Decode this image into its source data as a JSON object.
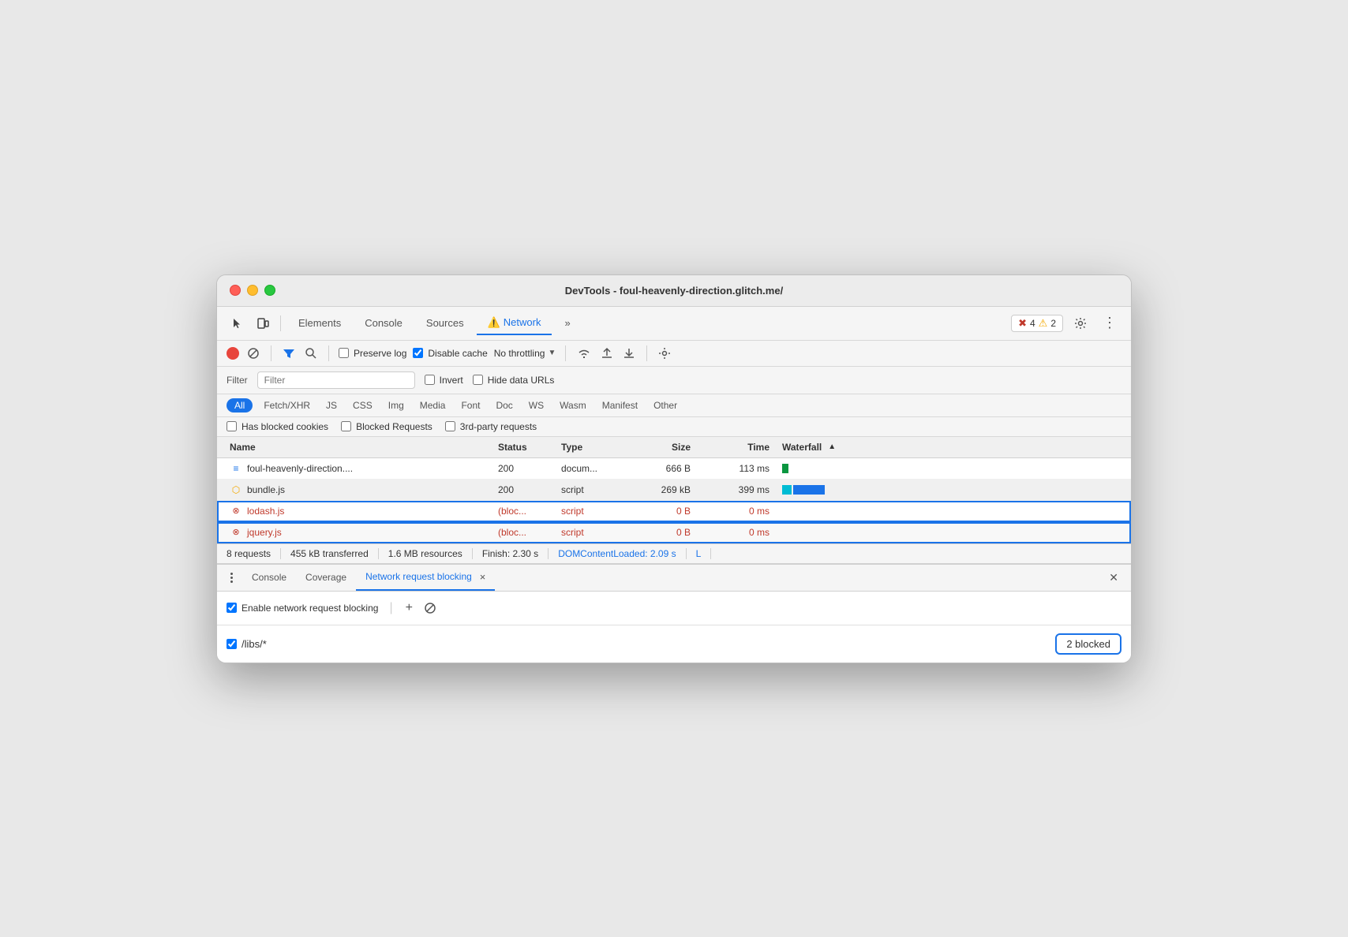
{
  "window": {
    "title": "DevTools - foul-heavenly-direction.glitch.me/"
  },
  "titlebar": {
    "title": "DevTools - foul-heavenly-direction.glitch.me/"
  },
  "tabs": {
    "items": [
      {
        "label": "Elements",
        "active": false
      },
      {
        "label": "Console",
        "active": false
      },
      {
        "label": "Sources",
        "active": false
      },
      {
        "label": "Network",
        "active": true,
        "warning": true
      },
      {
        "label": "»",
        "active": false
      }
    ]
  },
  "badges": {
    "error_count": "4",
    "warning_count": "2"
  },
  "network_toolbar": {
    "preserve_log": "Preserve log",
    "disable_cache": "Disable cache",
    "throttling": "No throttling"
  },
  "filter_bar": {
    "filter_label": "Filter",
    "invert_label": "Invert",
    "hide_data_urls_label": "Hide data URLs"
  },
  "type_filters": {
    "items": [
      "All",
      "Fetch/XHR",
      "JS",
      "CSS",
      "Img",
      "Media",
      "Font",
      "Doc",
      "WS",
      "Wasm",
      "Manifest",
      "Other"
    ],
    "active": "All"
  },
  "cookie_filters": {
    "has_blocked_cookies": "Has blocked cookies",
    "blocked_requests": "Blocked Requests",
    "third_party": "3rd-party requests"
  },
  "table": {
    "headers": [
      "Name",
      "Status",
      "Type",
      "Size",
      "Time",
      "Waterfall"
    ],
    "rows": [
      {
        "name": "foul-heavenly-direction....",
        "icon": "doc",
        "status": "200",
        "type": "docum...",
        "size": "666 B",
        "time": "113 ms",
        "blocked": false,
        "has_waterfall": true,
        "wf_type": "doc"
      },
      {
        "name": "bundle.js",
        "icon": "js",
        "status": "200",
        "type": "script",
        "size": "269 kB",
        "time": "399 ms",
        "blocked": false,
        "has_waterfall": true,
        "wf_type": "script"
      },
      {
        "name": "lodash.js",
        "icon": "blocked",
        "status": "(bloc...",
        "type": "script",
        "size": "0 B",
        "time": "0 ms",
        "blocked": true,
        "has_waterfall": false,
        "wf_type": null
      },
      {
        "name": "jquery.js",
        "icon": "blocked",
        "status": "(bloc...",
        "type": "script",
        "size": "0 B",
        "time": "0 ms",
        "blocked": true,
        "has_waterfall": false,
        "wf_type": null
      }
    ]
  },
  "status_bar": {
    "requests": "8 requests",
    "transferred": "455 kB transferred",
    "resources": "1.6 MB resources",
    "finish": "Finish: 2.30 s",
    "dom_content_loaded": "DOMContentLoaded: 2.09 s",
    "load": "L"
  },
  "bottom_panel": {
    "tabs": [
      "Console",
      "Coverage",
      "Network request blocking"
    ],
    "active_tab": "Network request blocking",
    "close_label": "×"
  },
  "blocking": {
    "enable_label": "Enable network request blocking",
    "add_icon": "+",
    "block_icon": "🚫",
    "pattern": "/libs/*",
    "blocked_count": "2 blocked"
  }
}
